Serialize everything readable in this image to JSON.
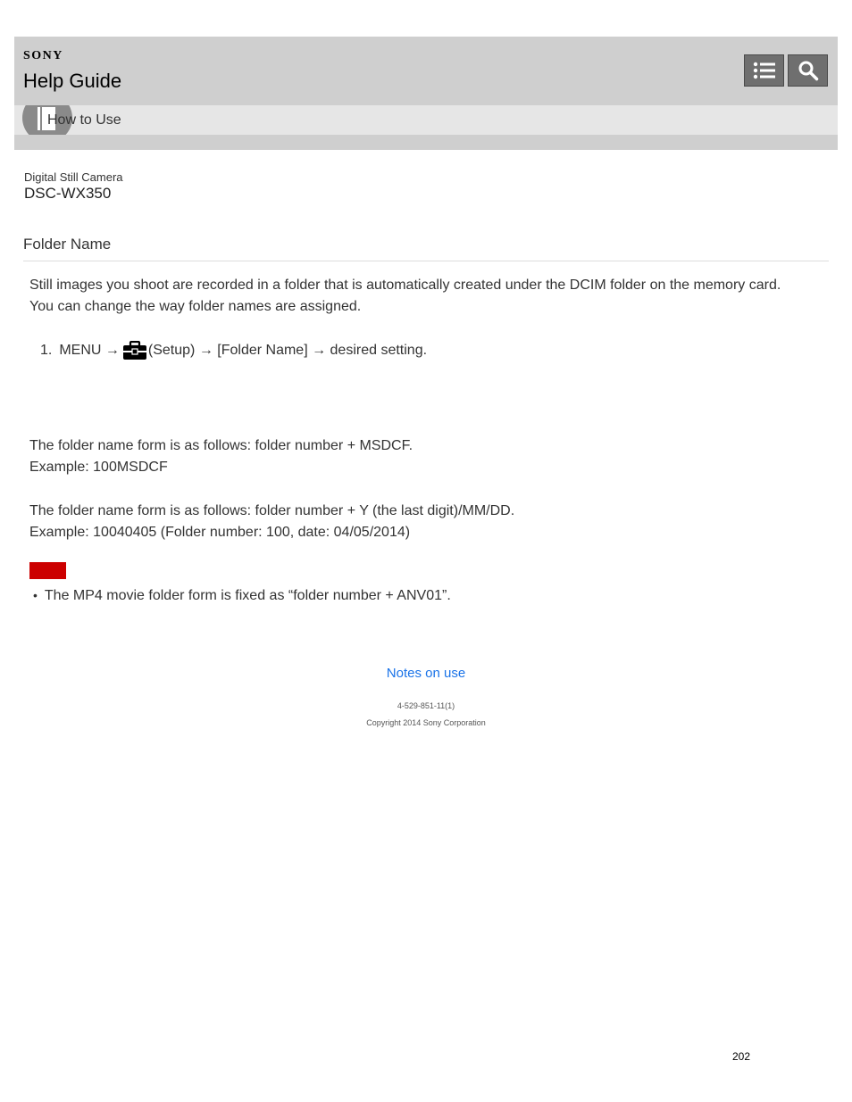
{
  "header": {
    "brand": "SONY",
    "title": "Help Guide",
    "subnav_label": "How to Use",
    "menu_icon": "list-menu-icon",
    "search_icon": "search-icon"
  },
  "product": {
    "category": "Digital Still Camera",
    "model": "DSC-WX350"
  },
  "page": {
    "title": "Folder Name",
    "intro_line1": "Still images you shoot are recorded in a folder that is automatically created under the DCIM folder on the memory card.",
    "intro_line2": "You can change the way folder names are assigned.",
    "step": {
      "number": "1.",
      "before_icon": "MENU →",
      "icon": "toolbox-setup-icon",
      "after_icon": "(Setup) → [Folder Name] → desired setting."
    },
    "option1_line1": "The folder name form is as follows: folder number + MSDCF.",
    "option1_line2": "Example: 100MSDCF",
    "option2_line1": "The folder name form is as follows: folder number + Y (the last digit)/MM/DD.",
    "option2_line2": "Example: 10040405 (Folder number: 100, date: 04/05/2014)",
    "note_bullet": "The MP4 movie folder form is fixed as “folder number + ANV01”."
  },
  "footer": {
    "link": "Notes on use",
    "doc_code": "4-529-851-11(1)",
    "copyright": "Copyright 2014 Sony Corporation",
    "page_number": "202"
  },
  "colors": {
    "header_bg": "#cfcfcf",
    "subnav_bg": "#e6e6e6",
    "button_bg": "#6f6f6f",
    "note_bar": "#cc0000",
    "link": "#1a73e8"
  }
}
